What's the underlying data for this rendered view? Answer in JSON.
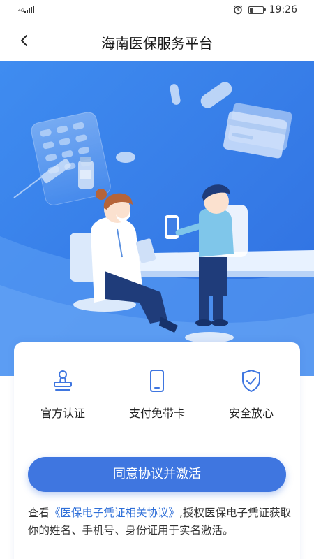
{
  "status_bar": {
    "network": "4G",
    "time": "19:26",
    "battery_level": 0.3
  },
  "header": {
    "title": "海南医保服务平台",
    "back_icon": "chevron-left-icon"
  },
  "features": [
    {
      "label": "官方认证",
      "icon": "stamp-icon"
    },
    {
      "label": "支付免带卡",
      "icon": "phone-icon"
    },
    {
      "label": "安全放心",
      "icon": "shield-check-icon"
    }
  ],
  "colors": {
    "primary": "#3f76e0",
    "link": "#2f6fd8",
    "hero_blue": "#3d86ec"
  },
  "agree_button": {
    "label": "同意协议并激活"
  },
  "notice": {
    "prefix": "查看",
    "link_text": "《医保电子凭证相关协议》",
    "suffix": ",授权医保电子凭证获取你的姓名、手机号、身份证用于实名激活。"
  }
}
